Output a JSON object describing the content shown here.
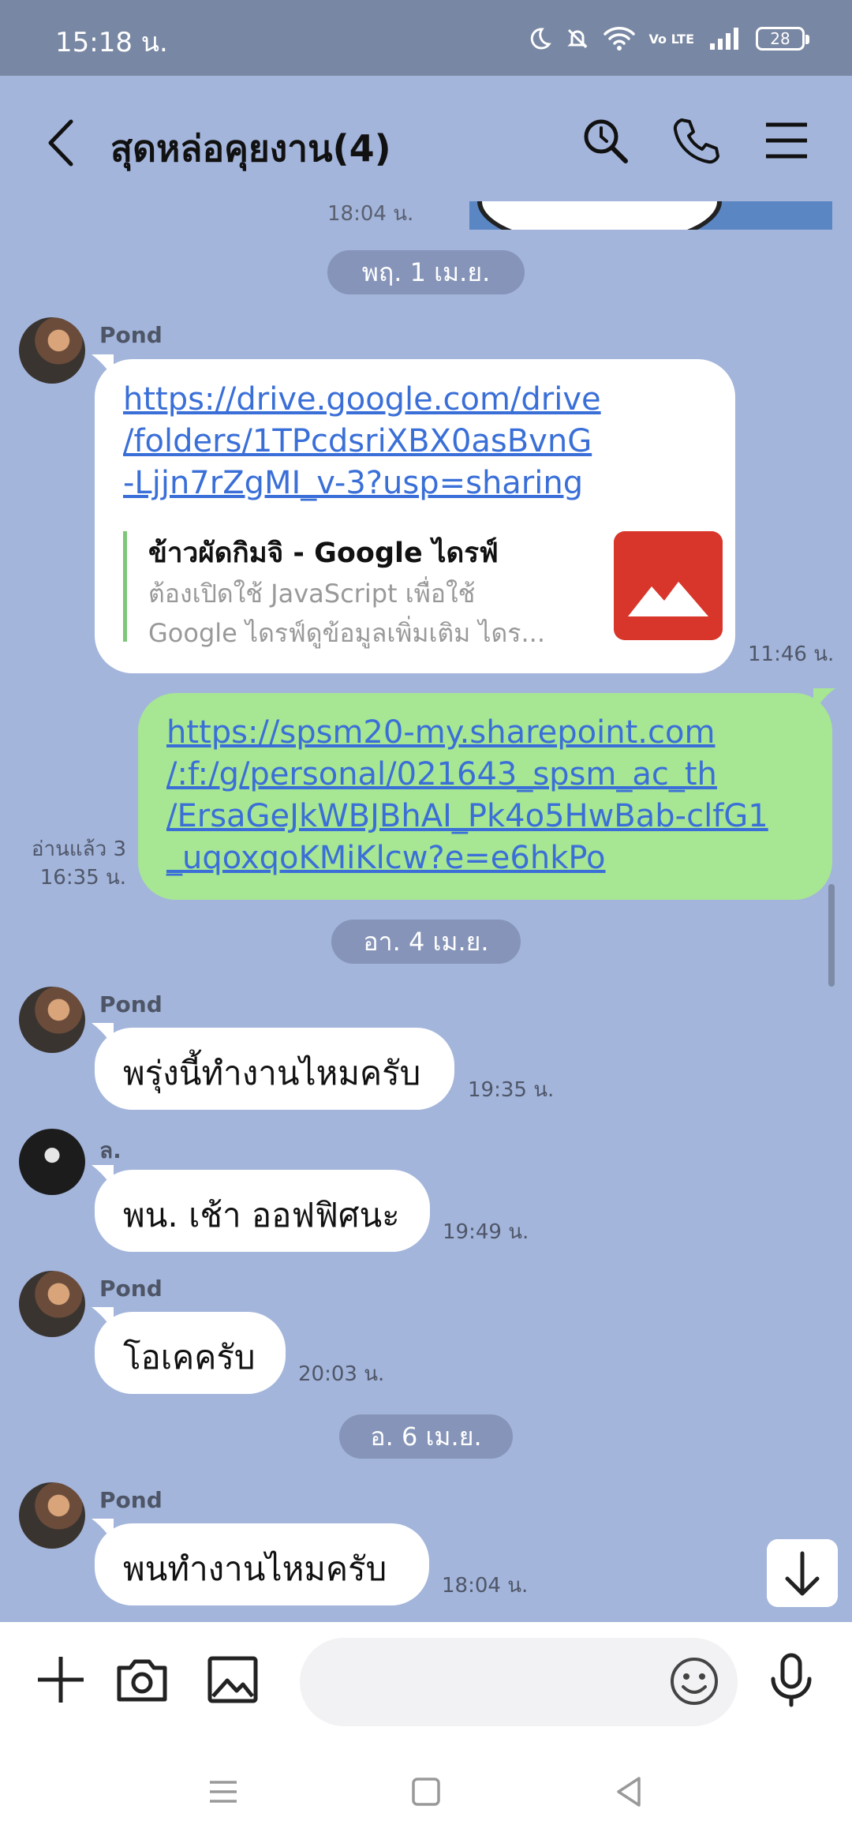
{
  "status_bar": {
    "time": "15:18 น.",
    "battery": "28",
    "network_label": "Vo LTE"
  },
  "header": {
    "title": "สุดหล่อคุยงาน(4)"
  },
  "previous": {
    "time": "18:04 น."
  },
  "dates": [
    "พฤ. 1 เม.ย.",
    "อา. 4 เม.ย.",
    "อ. 6 เม.ย."
  ],
  "messages": [
    {
      "sender": "Pond",
      "link_lines": [
        "https://drive.google.com/drive",
        "/folders/1TPcdsriXBX0asBvnG",
        "-Ljjn7rZgMI_v-3?usp=sharing"
      ],
      "preview_title": "ข้าวผัดกิมจิ - Google ไดรฟ์",
      "preview_desc_lines": [
        "ต้องเปิดใช้ JavaScript เพื่อใช้",
        "Google ไดรฟ์ดูข้อมูลเพิ่มเติม ไดร..."
      ],
      "time": "11:46 น."
    },
    {
      "sender": "me",
      "link_lines": [
        "https://spsm20-my.sharepoint.com",
        "/:f:/g/personal/021643_spsm_ac_th",
        "/ErsaGeJkWBJBhAI_Pk4o5HwBab-clfG1",
        "_uqoxqoKMiKlcw?e=e6hkPo"
      ],
      "read_label": "อ่านแล้ว 3",
      "time": "16:35 น."
    },
    {
      "sender": "Pond",
      "text": "พรุ่งนี้ทำงานไหมครับ",
      "time": "19:35 น."
    },
    {
      "sender": "ล.",
      "text": "พน. เช้า ออฟฟิศนะ",
      "time": "19:49 น."
    },
    {
      "sender": "Pond",
      "text": "โอเคครับ",
      "time": "20:03 น."
    },
    {
      "sender": "Pond",
      "text": "พนทำงานไหมครับ",
      "time": "18:04 น."
    }
  ],
  "input": {
    "placeholder": ""
  },
  "icons": {
    "back": "chevron-left-icon",
    "search": "search-icon",
    "call": "phone-icon",
    "menu": "menu-icon",
    "add": "plus-icon",
    "camera": "camera-icon",
    "gallery": "image-icon",
    "emoji": "smiley-icon",
    "mic": "microphone-icon",
    "jump": "arrow-down-icon"
  },
  "colors": {
    "chat_bg": "#a3b5db",
    "sent_bubble": "#a7e693",
    "link": "#3a6fd8",
    "status_bar": "#7887a3"
  }
}
